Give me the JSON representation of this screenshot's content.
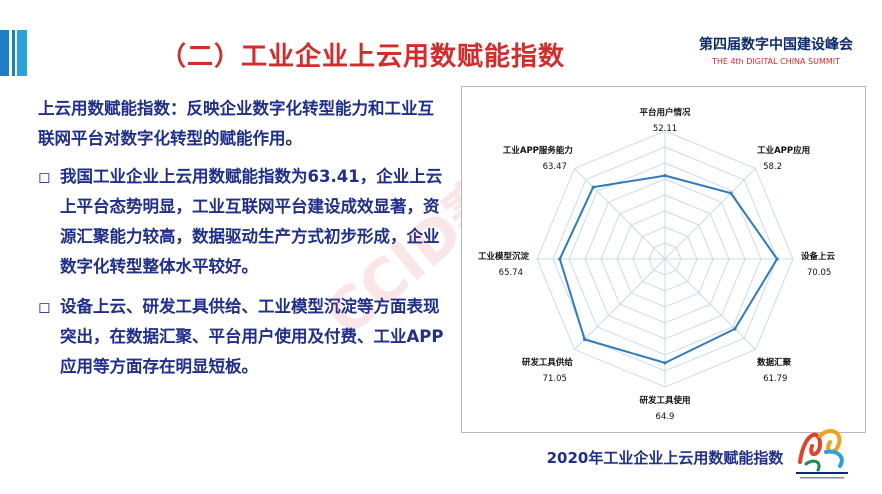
{
  "slide": {
    "title": "（二）工业企业上云用数赋能指数",
    "brand_cn": "第四届数字中国建设峰会",
    "brand_en": "THE 4th DIGITAL CHINA SUMMIT",
    "watermark": "CCID赛迪",
    "intro": "上云用数赋能指数：反映企业数字化转型能力和工业互联网平台对数字化转型的赋能作用。",
    "bullets": [
      "我国工业企业上云用数赋能指数为63.41，企业上云上平台态势明显，工业互联网平台建设成效显著，资源汇聚能力较高，数据驱动生产方式初步形成，企业数字化转型整体水平较好。",
      "设备上云、研发工具供给、工业模型沉淀等方面表现突出，在数据汇聚、平台用户使用及付费、工业APP应用等方面存在明显短板。"
    ],
    "bullet_icon": "hollow-square-bullet-icon",
    "chart_caption": "2020年工业企业上云用数赋能指数",
    "colors": {
      "title": "#d62b2b",
      "text": "#1f2f8a",
      "series": "#2e7bbf",
      "grid": "#c9dcec"
    }
  },
  "chart_data": {
    "type": "radar",
    "categories": [
      "平台用户情况",
      "工业APP应用",
      "设备上云",
      "数据汇聚",
      "研发工具使用",
      "研发工具供给",
      "工业模型沉淀",
      "工业APP服务能力"
    ],
    "values": [
      52.11,
      58.2,
      70.05,
      61.79,
      64.9,
      71.05,
      65.74,
      63.47
    ],
    "value_labels": [
      "52.11",
      "58.2",
      "70.05",
      "61.79",
      "64.9",
      "71.05",
      "65.74",
      "63.47"
    ],
    "rlim": [
      0,
      80
    ],
    "grid": true,
    "legend": "none"
  }
}
